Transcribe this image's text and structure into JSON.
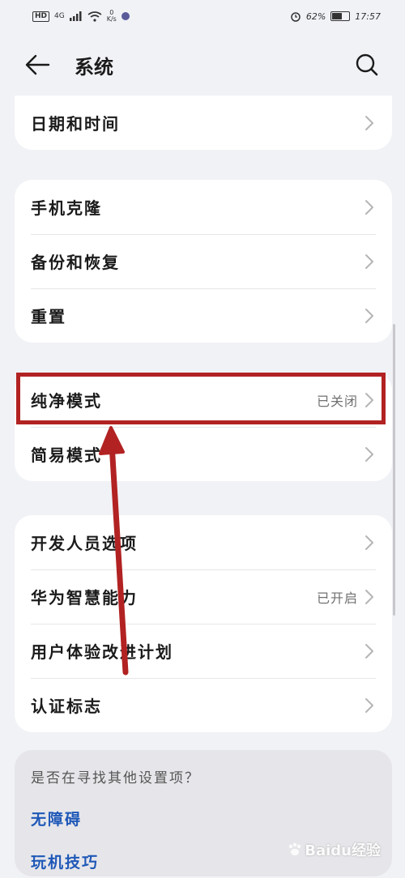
{
  "status_bar": {
    "hd": "HD",
    "network": "4G",
    "speed_value": "0",
    "speed_unit": "K/s",
    "battery": "62%",
    "time": "17:57",
    "battery_level": 0.62
  },
  "app_bar": {
    "title": "系统",
    "icons": [
      "back-icon",
      "search-icon"
    ]
  },
  "sections": [
    {
      "items": [
        {
          "label": "日期和时间"
        }
      ]
    },
    {
      "items": [
        {
          "label": "手机克隆"
        },
        {
          "label": "备份和恢复"
        },
        {
          "label": "重置"
        }
      ]
    },
    {
      "items": [
        {
          "label": "纯净模式",
          "status": "已关闭"
        },
        {
          "label": "简易模式"
        }
      ]
    },
    {
      "items": [
        {
          "label": "开发人员选项"
        },
        {
          "label": "华为智慧能力",
          "status": "已开启"
        },
        {
          "label": "用户体验改进计划"
        },
        {
          "label": "认证标志"
        }
      ]
    }
  ],
  "suggestions": {
    "title": "是否在寻找其他设置项？",
    "links": [
      "无障碍",
      "玩机技巧"
    ]
  },
  "watermark": "Baidu经验",
  "annotation": {
    "color": "#b22222"
  }
}
